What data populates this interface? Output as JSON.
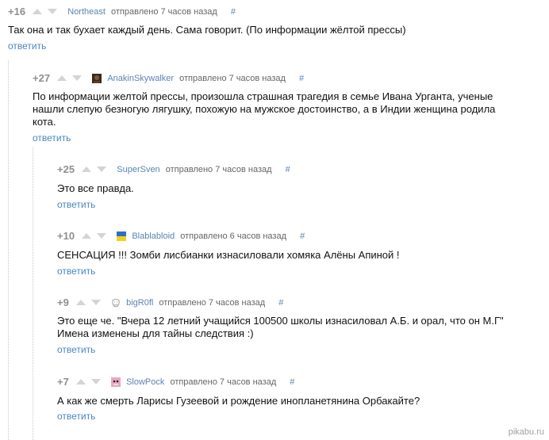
{
  "comments": [
    {
      "score": "+16",
      "user": "Northeast",
      "meta": "отправлено 7 часов назад",
      "hash": "#",
      "text": "Так она и так бухает каждый день. Сама говорит. (По информации жёлтой прессы)",
      "reply": "ответить",
      "avatar": "none"
    },
    {
      "score": "+27",
      "user": "AnakinSkywalker",
      "meta": "отправлено 7 часов назад",
      "hash": "#",
      "text": "По информации желтой прессы, произошла страшная трагедия в семье Ивана Урганта, ученые нашли слепую безногую лягушку, похожую на мужское достоинство, а в Индии женщина родила кота.",
      "reply": "ответить",
      "avatar": "dark-avatar-icon"
    },
    {
      "score": "+25",
      "user": "SuperSven",
      "meta": "отправлено 7 часов назад",
      "hash": "#",
      "text": "Это все правда.",
      "reply": "ответить",
      "avatar": "none"
    },
    {
      "score": "+10",
      "user": "Blablabloid",
      "meta": "отправлено 6 часов назад",
      "hash": "#",
      "text": "СЕНСАЦИЯ !!! Зомби лисбианки изнасиловали хомяка Алёны Апиной !",
      "reply": "ответить",
      "avatar": "ukraine-flag-icon"
    },
    {
      "score": "+9",
      "user": "bigR0fl",
      "meta": "отправлено 7 часов назад",
      "hash": "#",
      "text": "Это еще че. \"Вчера 12 летний учащийся 100500 школы изнасиловал А.Б. и орал, что он М.Г\" Имена изменены для тайны следствия :)",
      "reply": "ответить",
      "avatar": "trollface-icon"
    },
    {
      "score": "+7",
      "user": "SlowPock",
      "meta": "отправлено 7 часов назад",
      "hash": "#",
      "text": "А как же смерть Ларисы Гузеевой и рождение инопланетянина Орбакайте?",
      "reply": "ответить",
      "avatar": "slowpoke-avatar-icon"
    }
  ],
  "watermark": "pikabu.ru"
}
